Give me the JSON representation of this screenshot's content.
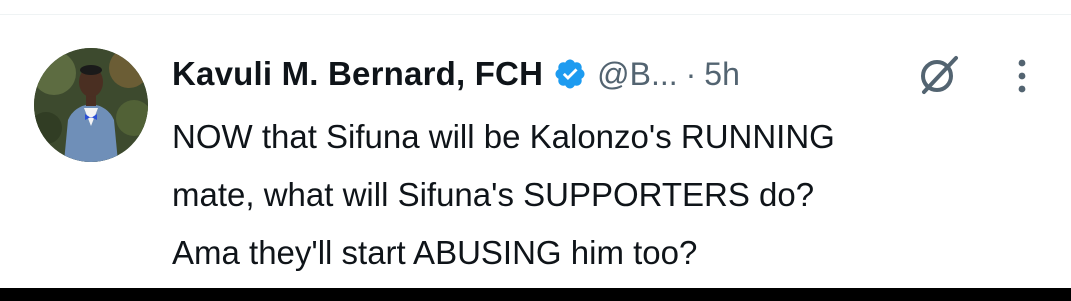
{
  "tweet": {
    "author": {
      "display_name": "Kavuli M. Bernard, FCH",
      "handle": "@B...",
      "verified": true
    },
    "separator": "·",
    "timestamp": "5h",
    "text_lines": [
      "NOW that Sifuna will be Kalonzo's RUNNING",
      "mate, what will Sifuna's SUPPORTERS do?",
      "Ama they'll start ABUSING him too?"
    ]
  },
  "icons": {
    "verified": "verified-badge-icon",
    "grok": "grok-icon",
    "more": "more-options-icon"
  },
  "colors": {
    "text_primary": "#0f1419",
    "text_secondary": "#536471",
    "verified_blue": "#1d9bf0"
  }
}
